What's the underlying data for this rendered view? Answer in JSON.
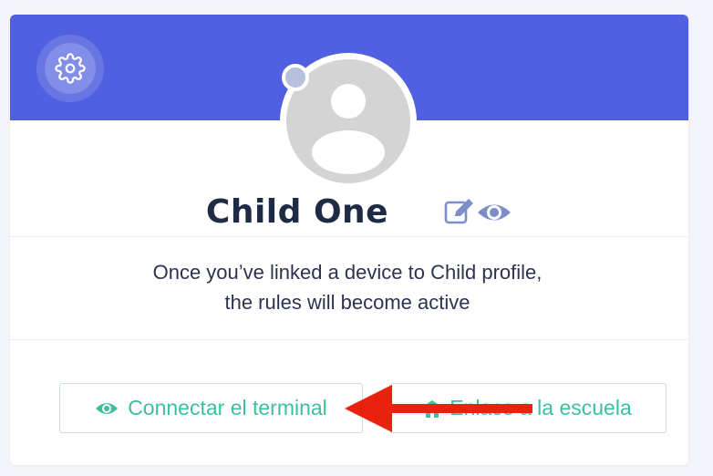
{
  "profile": {
    "name": "Child One",
    "message": "Once you’ve linked a device to Child profile, the rules will become active"
  },
  "actions": {
    "connect_label": "Connectar el terminal",
    "school_label": "Enlace a la escuela"
  },
  "icons": {
    "settings": "gear-icon",
    "edit": "edit-icon",
    "view": "eye-icon",
    "connect": "eye-icon",
    "school": "school-icon",
    "annotation": "arrow-icon"
  },
  "colors": {
    "banner": "#5060e0",
    "accent": "#3cbfa0",
    "name_text": "#1f2a44",
    "icon_blue": "#7c8dc9",
    "annotation_arrow": "#e8220e",
    "avatar_placeholder": "#d4d4d4"
  }
}
